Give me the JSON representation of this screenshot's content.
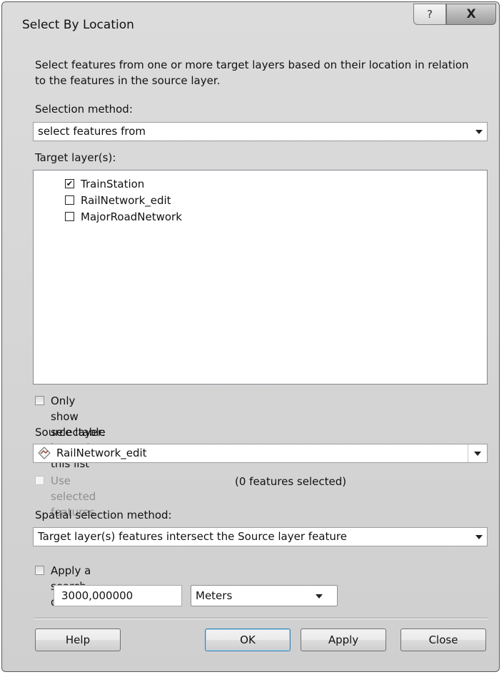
{
  "window": {
    "title": "Select By Location",
    "help_glyph": "?",
    "close_glyph": "X"
  },
  "description": "Select features from one or more target layers based on their location in relation to the features in the source layer.",
  "selection_method": {
    "label": "Selection method:",
    "value": "select features from"
  },
  "target_layers": {
    "label": "Target layer(s):",
    "items": [
      {
        "name": "TrainStation",
        "checked": true
      },
      {
        "name": "RailNetwork_edit",
        "checked": false
      },
      {
        "name": "MajorRoadNetwork",
        "checked": false
      }
    ]
  },
  "only_selectable": {
    "label": "Only show selectable layers in this list",
    "checked": false
  },
  "source_layer": {
    "label": "Source layer:",
    "value": "RailNetwork_edit"
  },
  "use_selected": {
    "label": "Use selected features",
    "count_text": "(0 features selected)",
    "enabled": false
  },
  "spatial_method": {
    "label": "Spatial selection method:",
    "value": "Target layer(s) features intersect the Source layer feature"
  },
  "search_distance": {
    "label": "Apply a search distance",
    "checked": false,
    "value": "3000,000000",
    "units": "Meters"
  },
  "buttons": {
    "help": "Help",
    "ok": "OK",
    "apply": "Apply",
    "close": "Close"
  }
}
